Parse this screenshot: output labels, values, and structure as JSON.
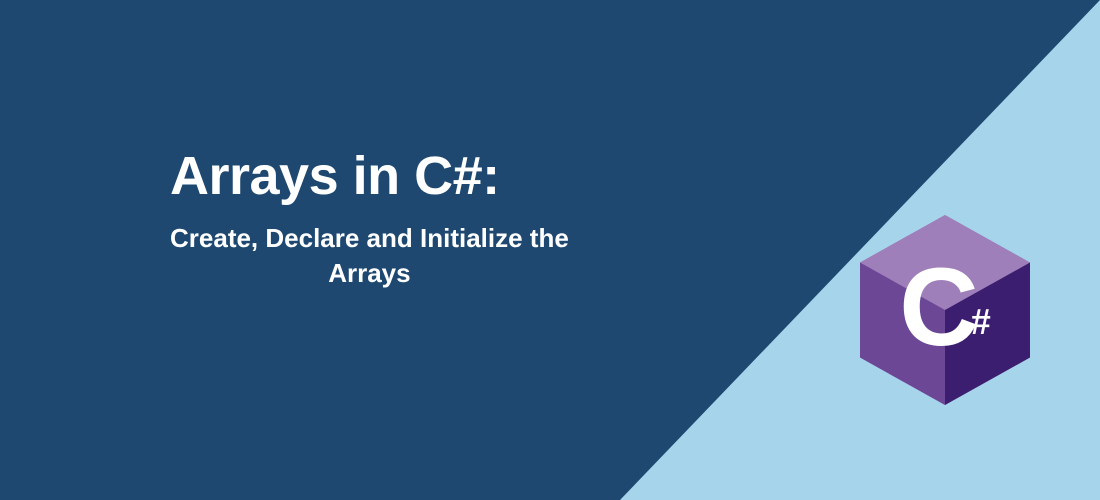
{
  "banner": {
    "title": "Arrays in C#:",
    "subtitle_line1": "Create, Declare and Initialize the",
    "subtitle_line2": "Arrays"
  },
  "logo": {
    "letter": "C",
    "hash": "#",
    "color_top": "#9e7fb9",
    "color_left": "#6b4796",
    "color_right": "#3b1e6f"
  },
  "colors": {
    "background_dark": "#1e4870",
    "background_light": "#a6d5eb",
    "text": "#ffffff"
  }
}
